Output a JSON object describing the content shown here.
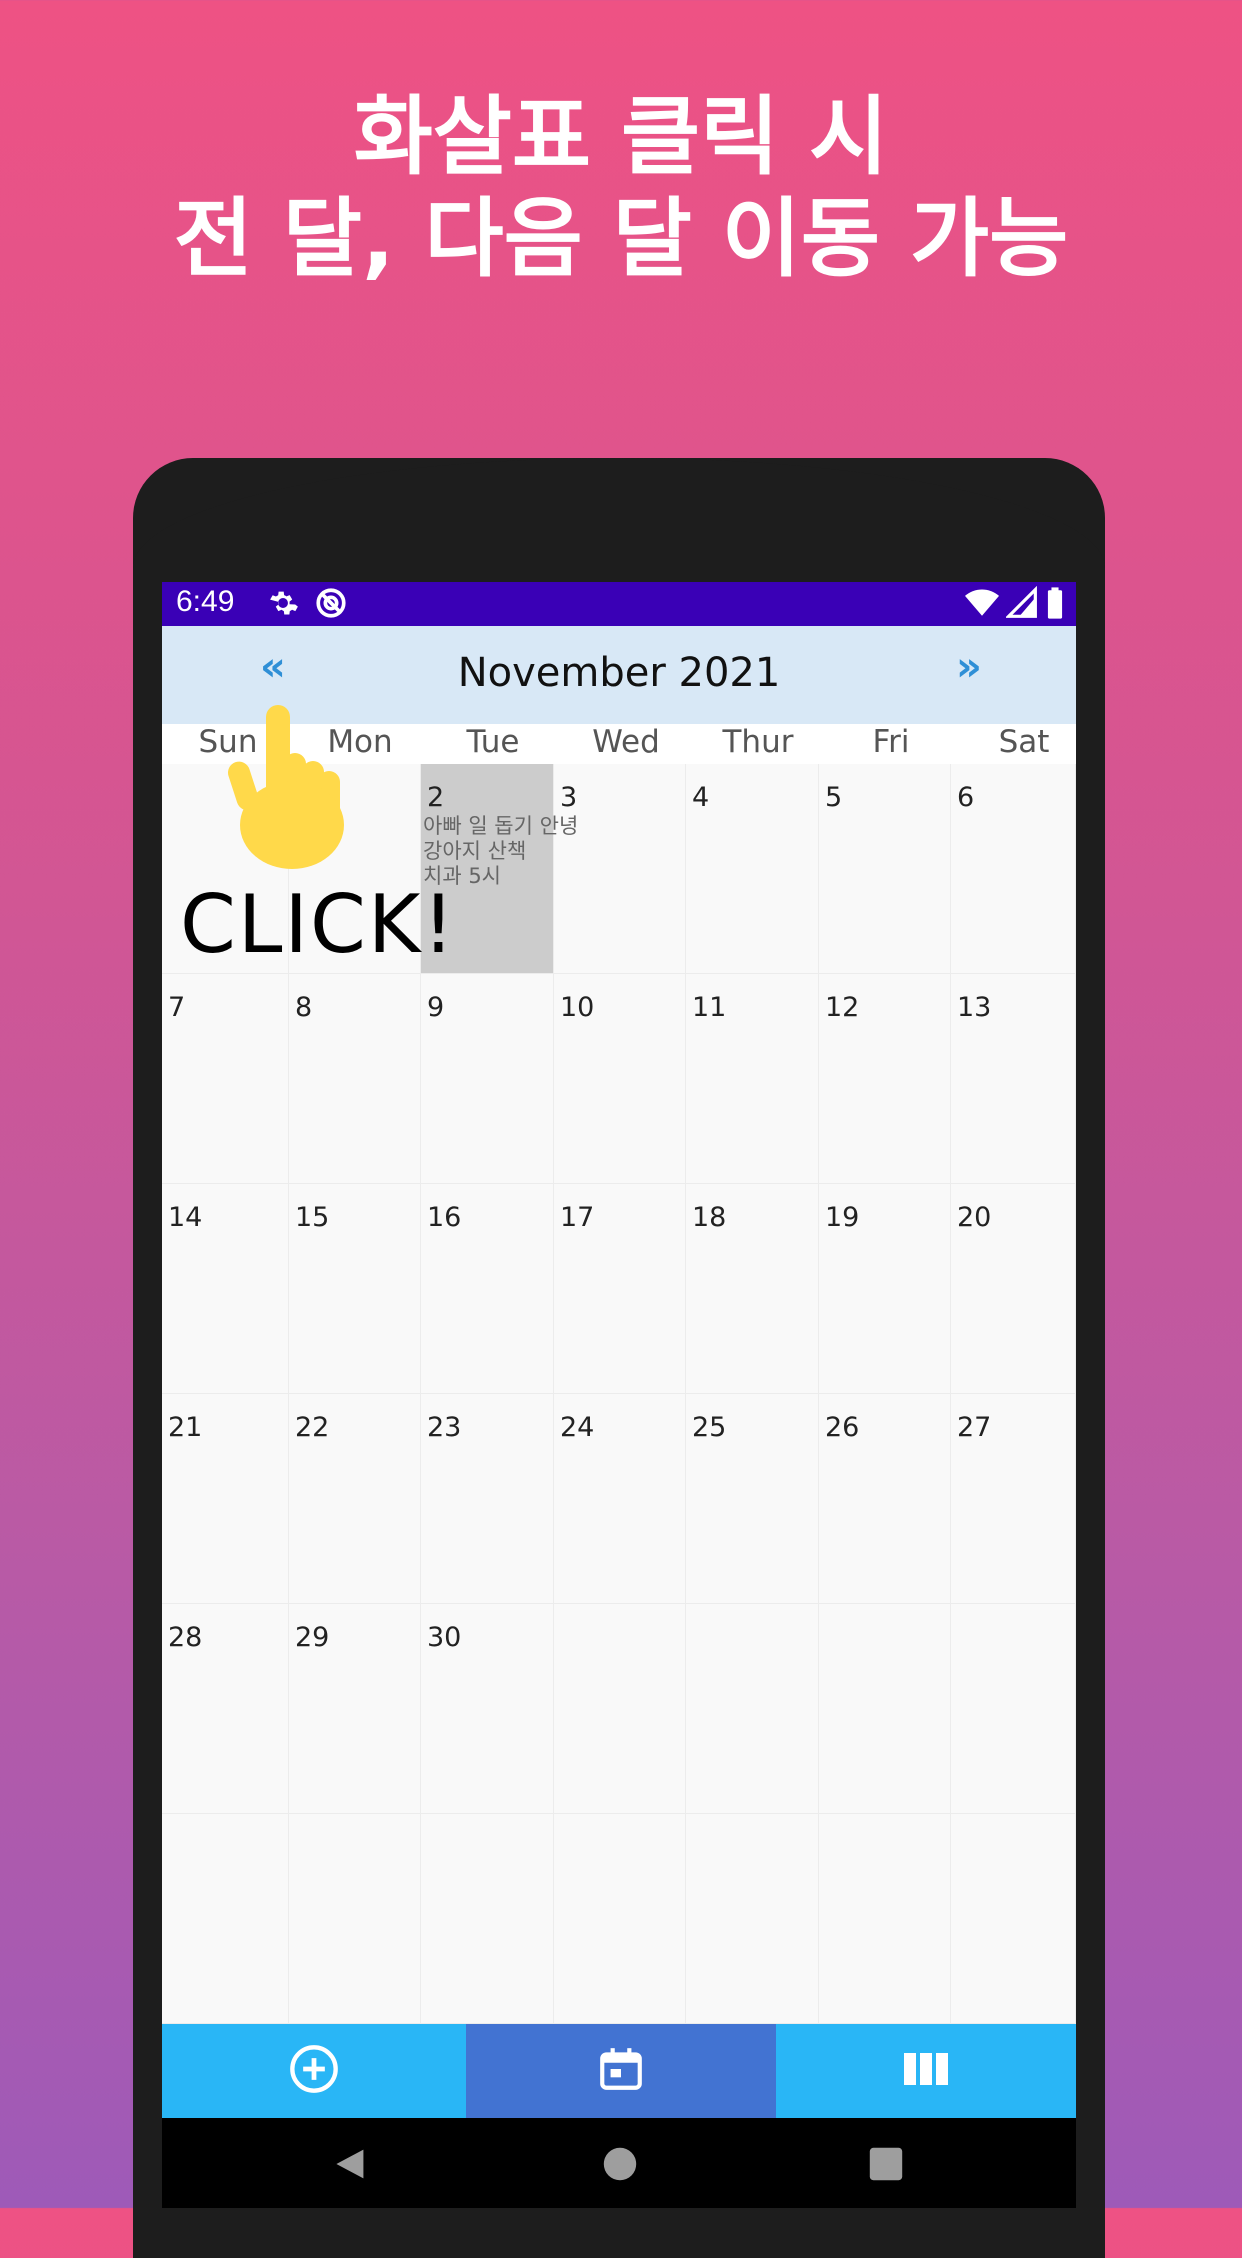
{
  "headline": {
    "line1": "화살표 클릭 시",
    "line2": "전 달, 다음 달 이동 가능"
  },
  "statusbar": {
    "time": "6:49",
    "icons_left": [
      "gear-icon",
      "sync-icon"
    ],
    "icons_right": [
      "wifi-icon",
      "signal-icon",
      "battery-icon"
    ]
  },
  "calendar": {
    "prev_label": "«",
    "next_label": "»",
    "month_title": "November 2021",
    "weekdays": [
      "Sun",
      "Mon",
      "Tue",
      "Wed",
      "Thur",
      "Fri",
      "Sat"
    ],
    "selected_day": "2",
    "weeks": [
      [
        "",
        "",
        "2",
        "3",
        "4",
        "5",
        "6"
      ],
      [
        "7",
        "8",
        "9",
        "10",
        "11",
        "12",
        "13"
      ],
      [
        "14",
        "15",
        "16",
        "17",
        "18",
        "19",
        "20"
      ],
      [
        "21",
        "22",
        "23",
        "24",
        "25",
        "26",
        "27"
      ],
      [
        "28",
        "29",
        "30",
        "",
        "",
        "",
        ""
      ],
      [
        "",
        "",
        "",
        "",
        "",
        "",
        ""
      ]
    ],
    "events_day2": [
      "아빠 일 돕기 안녕",
      "강아지 산책",
      "치과 5시"
    ]
  },
  "annotation": {
    "click_text": "CLICK!"
  },
  "bottom_nav": {
    "tabs": [
      "add-circle-icon",
      "calendar-icon",
      "columns-icon"
    ],
    "active_index": 1
  },
  "system_nav": [
    "back-icon",
    "home-icon",
    "recents-icon"
  ],
  "colors": {
    "status_bar": "#3a00b6",
    "header_bg": "#d8e8f6",
    "arrow": "#2f8fd6",
    "bottom_nav": "#29b6f6",
    "bottom_nav_active": "#4273d2",
    "selected_cell": "#cccccc"
  }
}
